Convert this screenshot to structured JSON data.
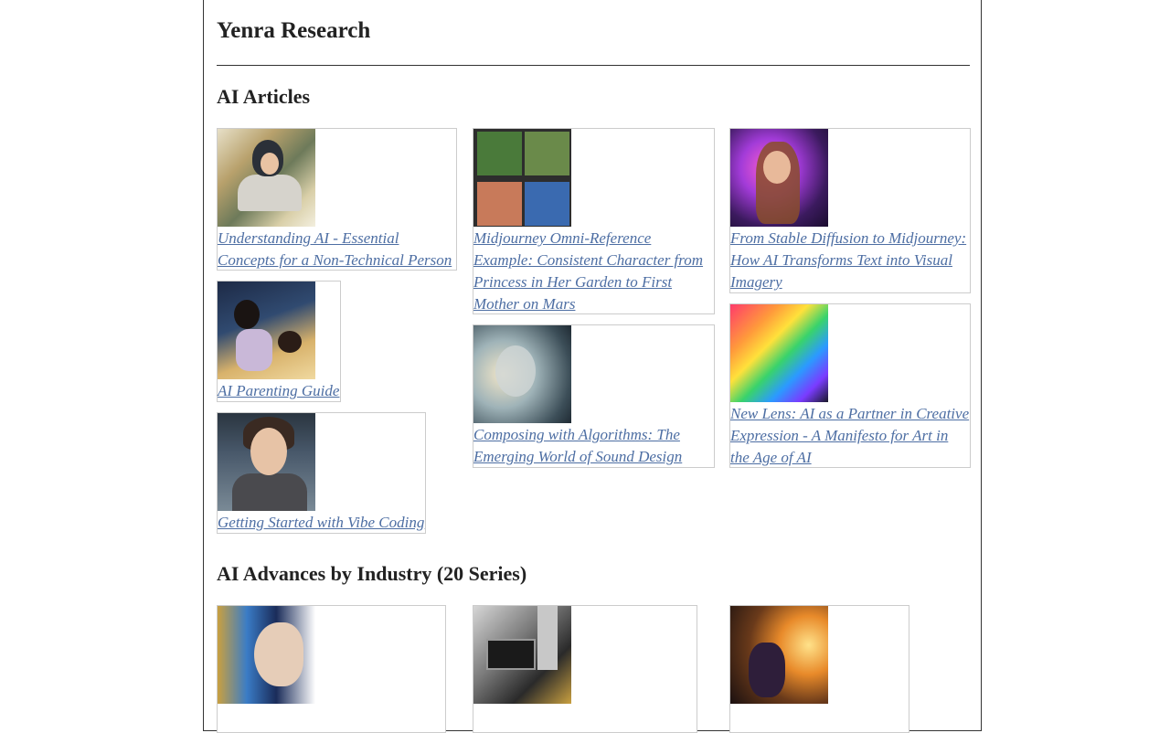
{
  "site": {
    "title": "Yenra Research"
  },
  "sections": [
    {
      "heading": "AI Articles"
    },
    {
      "heading": "AI Advances by Industry (20 Series)"
    }
  ],
  "articles": [
    {
      "title": "Understanding AI - Essential Concepts for a Non-Technical Person",
      "image": "girl-writing-image"
    },
    {
      "title": "AI Parenting Guide",
      "image": "mother-child-image"
    },
    {
      "title": "Getting Started with Vibe Coding",
      "image": "woman-at-computer-image"
    },
    {
      "title": "Midjourney Omni-Reference Example: Consistent Character from Princess in Her Garden to First Mother on Mars",
      "image": "character-grid-image"
    },
    {
      "title": "Composing with Algorithms: The Emerging World of Sound Design",
      "image": "sound-design-image"
    },
    {
      "title": "From Stable Diffusion to Midjourney: How AI Transforms Text into Visual Imagery",
      "image": "neon-portrait-image"
    },
    {
      "title": "New Lens: AI as a Partner in Creative Expression - A Manifesto for Art in the Age of AI",
      "image": "rainbow-feathers-image"
    }
  ],
  "industries": [
    {
      "image": "ai-woman-profile-image"
    },
    {
      "image": "machinery-image"
    },
    {
      "image": "vineyard-grapes-image"
    }
  ]
}
